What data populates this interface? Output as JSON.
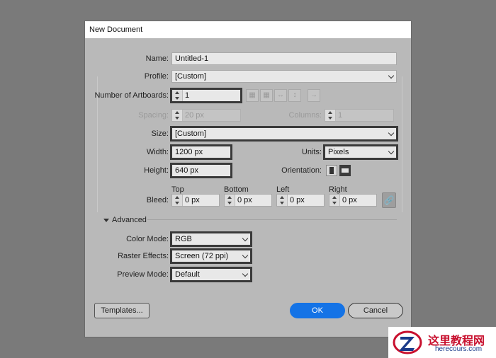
{
  "dialog": {
    "title": "New Document"
  },
  "form": {
    "name_label": "Name:",
    "name_value": "Untitled-1",
    "profile_label": "Profile:",
    "profile_value": "[Custom]",
    "artboards_label": "Number of Artboards:",
    "artboards_value": "1",
    "arrow_icon": "→",
    "spacing_label": "Spacing:",
    "spacing_value": "20 px",
    "columns_label": "Columns:",
    "columns_value": "1",
    "size_label": "Size:",
    "size_value": "[Custom]",
    "width_label": "Width:",
    "width_value": "1200 px",
    "units_label": "Units:",
    "units_value": "Pixels",
    "height_label": "Height:",
    "height_value": "640 px",
    "orientation_label": "Orientation:",
    "bleed_label": "Bleed:",
    "bleed_top_label": "Top",
    "bleed_top_value": "0 px",
    "bleed_bottom_label": "Bottom",
    "bleed_bottom_value": "0 px",
    "bleed_left_label": "Left",
    "bleed_left_value": "0 px",
    "bleed_right_label": "Right",
    "bleed_right_value": "0 px",
    "link_icon": "🔗"
  },
  "advanced": {
    "toggle_label": "Advanced",
    "color_mode_label": "Color Mode:",
    "color_mode_value": "RGB",
    "raster_label": "Raster Effects:",
    "raster_value": "Screen (72 ppi)",
    "preview_label": "Preview Mode:",
    "preview_value": "Default"
  },
  "buttons": {
    "templates": "Templates...",
    "ok": "OK",
    "cancel": "Cancel"
  },
  "watermark": {
    "cn_text": "这里教程网",
    "url": "herecours.com"
  },
  "colors": {
    "accent": "#1473e6",
    "dialog_bg": "#b9b9b9",
    "backdrop": "#7a7a7a"
  }
}
